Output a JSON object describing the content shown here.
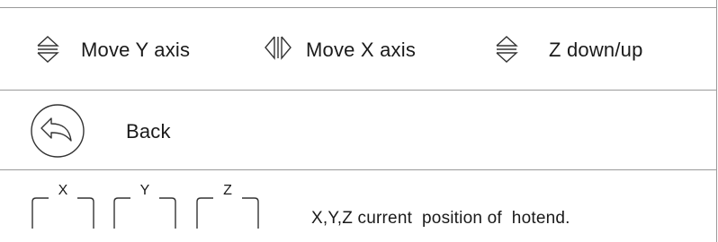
{
  "controls": {
    "move_y": {
      "icon": "up-down-arrows-icon",
      "label": "Move Y axis"
    },
    "move_x": {
      "icon": "left-right-arrows-icon",
      "label": "Move X axis"
    },
    "z": {
      "icon": "up-down-arrows-icon",
      "label": "Z down/up"
    }
  },
  "back": {
    "icon": "back-arrow-icon",
    "label": "Back"
  },
  "position": {
    "axes": [
      "X",
      "Y",
      "Z"
    ],
    "description": "X,Y,Z current  position of  hotend."
  },
  "colors": {
    "line": "#9a9a9a",
    "stroke": "#333333",
    "text": "#1a1a1a"
  }
}
